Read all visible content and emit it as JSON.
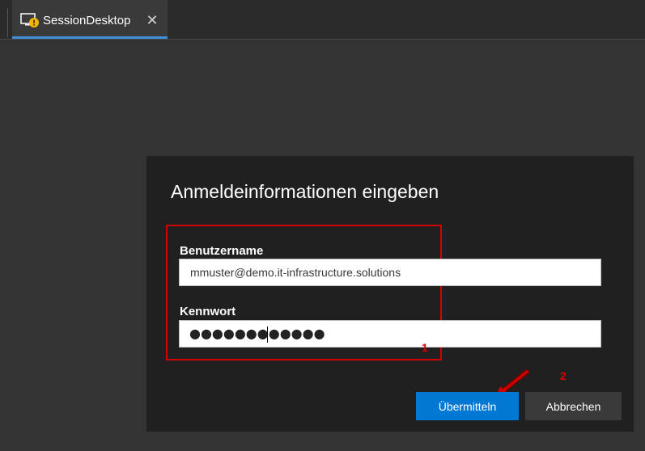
{
  "tab": {
    "title": "SessionDesktop",
    "close_symbol": "✕",
    "icon": "remote-desktop-warning-icon"
  },
  "dialog": {
    "title": "Anmeldeinformationen eingeben",
    "username_label": "Benutzername",
    "username_value": "mmuster@demo.it-infrastructure.solutions",
    "password_label": "Kennwort",
    "password_masked": "●●●●●●●●●●●●",
    "submit_label": "Übermitteln",
    "cancel_label": "Abbrechen"
  },
  "annotations": {
    "marker_1": "1",
    "marker_2": "2",
    "color": "#d40000"
  },
  "colors": {
    "accent": "#0078d4",
    "tab_underline": "#3d8fd8",
    "background": "#333333",
    "dialog_background": "#202020"
  }
}
